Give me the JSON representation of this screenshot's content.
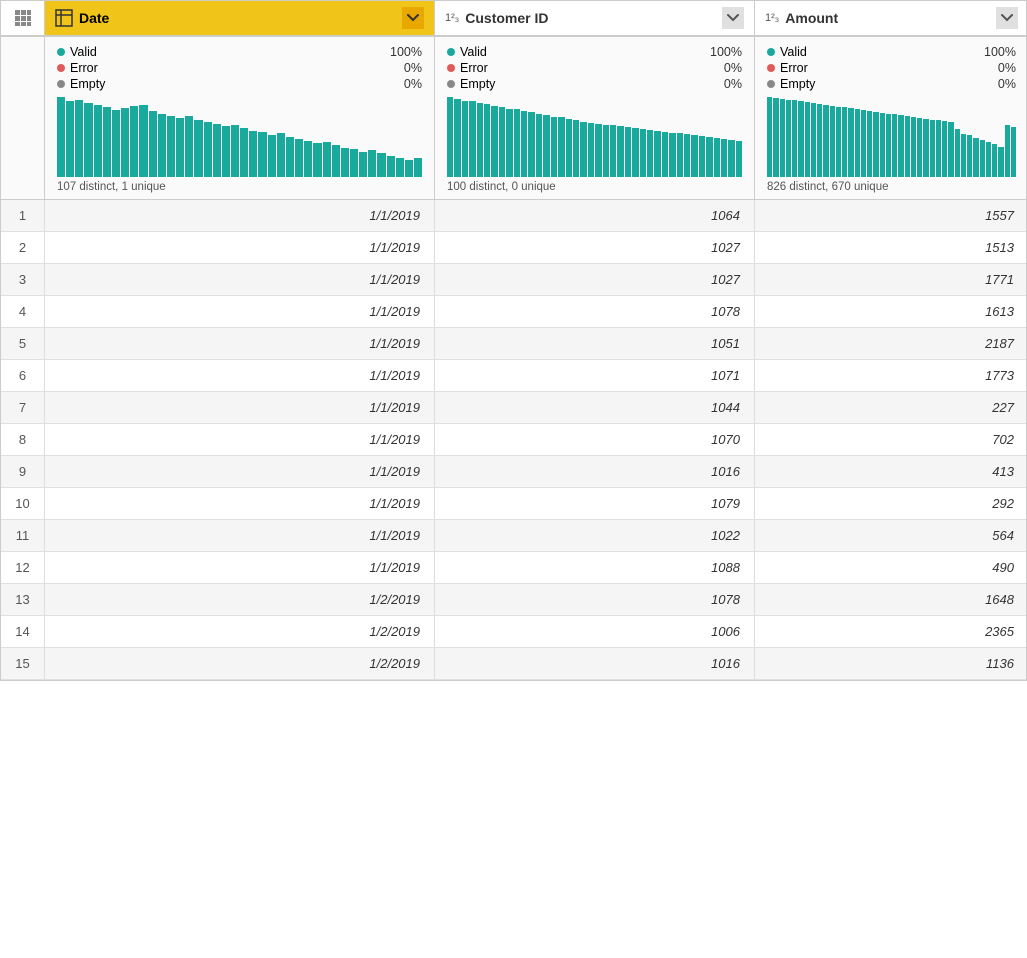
{
  "columns": {
    "corner": {
      "icon": "grid-icon"
    },
    "date": {
      "label": "Date",
      "type_icon": "table",
      "type_label": "",
      "stats": {
        "valid_pct": "100%",
        "error_pct": "0%",
        "empty_pct": "0%",
        "valid_label": "Valid",
        "error_label": "Error",
        "empty_label": "Empty",
        "distinct": "107 distinct, 1 unique"
      },
      "bars": [
        95,
        90,
        92,
        88,
        85,
        83,
        80,
        82,
        84,
        86,
        78,
        75,
        73,
        70,
        72,
        68,
        65,
        63,
        60,
        62,
        58,
        55,
        53,
        50,
        52,
        48,
        45,
        43,
        40,
        42,
        38,
        35,
        33,
        30,
        32,
        28,
        25,
        23,
        20,
        22
      ]
    },
    "customer_id": {
      "label": "Customer ID",
      "type_icon": "123",
      "stats": {
        "valid_pct": "100%",
        "error_pct": "0%",
        "empty_pct": "0%",
        "valid_label": "Valid",
        "error_label": "Error",
        "empty_label": "Empty",
        "distinct": "100 distinct, 0 unique"
      },
      "bars": [
        90,
        88,
        86,
        85,
        83,
        82,
        80,
        79,
        77,
        76,
        74,
        73,
        71,
        70,
        68,
        67,
        65,
        64,
        62,
        61,
        60,
        59,
        58,
        57,
        56,
        55,
        54,
        53,
        52,
        51,
        50,
        49,
        48,
        47,
        46,
        45,
        44,
        43,
        42,
        41
      ]
    },
    "amount": {
      "label": "Amount",
      "type_icon": "123",
      "stats": {
        "valid_pct": "100%",
        "error_pct": "0%",
        "empty_pct": "0%",
        "valid_label": "Valid",
        "error_label": "Error",
        "empty_label": "Empty",
        "distinct": "826 distinct, 670 unique"
      },
      "bars": [
        92,
        91,
        90,
        89,
        88,
        87,
        86,
        85,
        84,
        83,
        82,
        81,
        80,
        79,
        78,
        77,
        76,
        75,
        74,
        73,
        72,
        71,
        70,
        69,
        68,
        67,
        66,
        65,
        64,
        63,
        55,
        50,
        48,
        45,
        42,
        40,
        38,
        35,
        60,
        58
      ]
    }
  },
  "rows": [
    {
      "num": 1,
      "date": "1/1/2019",
      "customer_id": "1064",
      "amount": "1557"
    },
    {
      "num": 2,
      "date": "1/1/2019",
      "customer_id": "1027",
      "amount": "1513"
    },
    {
      "num": 3,
      "date": "1/1/2019",
      "customer_id": "1027",
      "amount": "1771"
    },
    {
      "num": 4,
      "date": "1/1/2019",
      "customer_id": "1078",
      "amount": "1613"
    },
    {
      "num": 5,
      "date": "1/1/2019",
      "customer_id": "1051",
      "amount": "2187"
    },
    {
      "num": 6,
      "date": "1/1/2019",
      "customer_id": "1071",
      "amount": "1773"
    },
    {
      "num": 7,
      "date": "1/1/2019",
      "customer_id": "1044",
      "amount": "227"
    },
    {
      "num": 8,
      "date": "1/1/2019",
      "customer_id": "1070",
      "amount": "702"
    },
    {
      "num": 9,
      "date": "1/1/2019",
      "customer_id": "1016",
      "amount": "413"
    },
    {
      "num": 10,
      "date": "1/1/2019",
      "customer_id": "1079",
      "amount": "292"
    },
    {
      "num": 11,
      "date": "1/1/2019",
      "customer_id": "1022",
      "amount": "564"
    },
    {
      "num": 12,
      "date": "1/1/2019",
      "customer_id": "1088",
      "amount": "490"
    },
    {
      "num": 13,
      "date": "1/2/2019",
      "customer_id": "1078",
      "amount": "1648"
    },
    {
      "num": 14,
      "date": "1/2/2019",
      "customer_id": "1006",
      "amount": "2365"
    },
    {
      "num": 15,
      "date": "1/2/2019",
      "customer_id": "1016",
      "amount": "1136"
    }
  ]
}
